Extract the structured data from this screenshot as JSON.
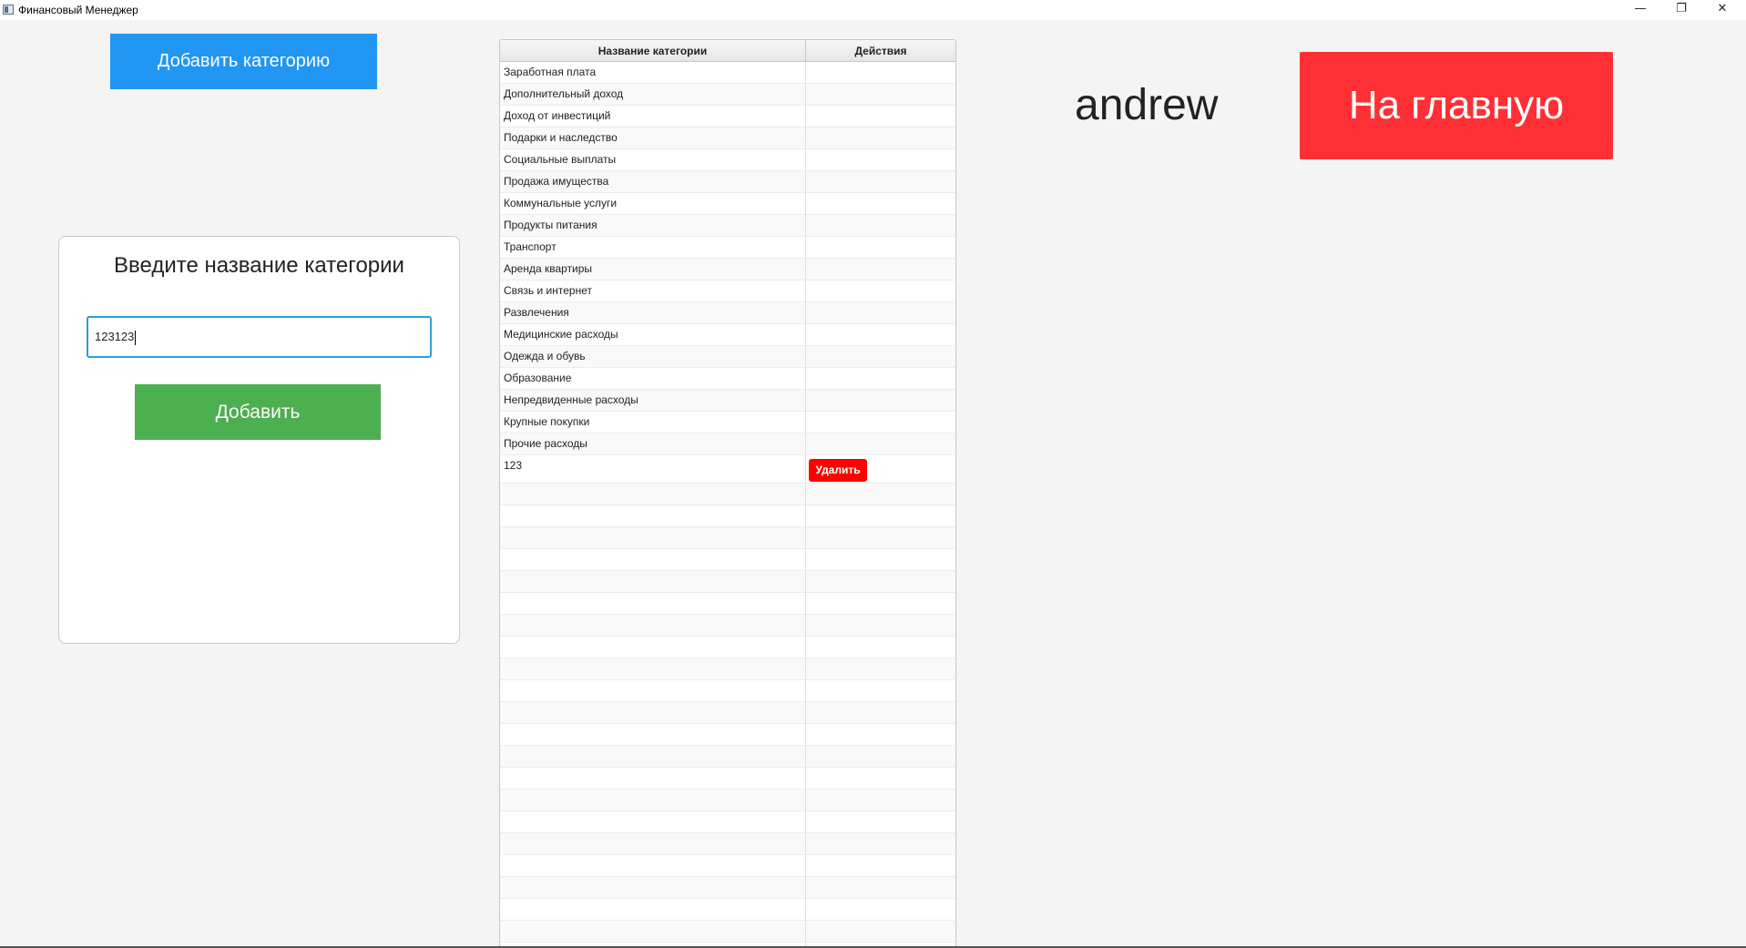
{
  "window": {
    "title": "Финансовый Менеджер",
    "minimize_glyph": "—",
    "restore_glyph": "❐",
    "close_glyph": "✕"
  },
  "toolbar": {
    "add_category_label": "Добавить категорию",
    "home_label": "На главную"
  },
  "user": {
    "name": "andrew"
  },
  "form": {
    "title": "Введите название категории",
    "input_value": "123123",
    "submit_label": "Добавить"
  },
  "table": {
    "headers": [
      "Название категории",
      "Действия"
    ],
    "rows": [
      {
        "name": "Заработная плата",
        "action": ""
      },
      {
        "name": "Дополнительный доход",
        "action": ""
      },
      {
        "name": "Доход от инвестиций",
        "action": ""
      },
      {
        "name": "Подарки и наследство",
        "action": ""
      },
      {
        "name": "Социальные выплаты",
        "action": ""
      },
      {
        "name": "Продажа имущества",
        "action": ""
      },
      {
        "name": "Коммунальные услуги",
        "action": ""
      },
      {
        "name": "Продукты питания",
        "action": ""
      },
      {
        "name": "Транспорт",
        "action": ""
      },
      {
        "name": "Аренда квартиры",
        "action": ""
      },
      {
        "name": "Связь и интернет",
        "action": ""
      },
      {
        "name": "Развлечения",
        "action": ""
      },
      {
        "name": "Медицинские расходы",
        "action": ""
      },
      {
        "name": "Одежда и обувь",
        "action": ""
      },
      {
        "name": "Образование",
        "action": ""
      },
      {
        "name": "Непредвиденные расходы",
        "action": ""
      },
      {
        "name": "Крупные покупки",
        "action": ""
      },
      {
        "name": "Прочие расходы",
        "action": ""
      },
      {
        "name": "123",
        "action": "Удалить"
      }
    ]
  },
  "colors": {
    "add_category_button": "#2196f3",
    "home_button": "#ff3035",
    "submit_button": "#4caf50",
    "delete_button": "#ff0000",
    "input_focus_border": "#2a9fd6"
  }
}
